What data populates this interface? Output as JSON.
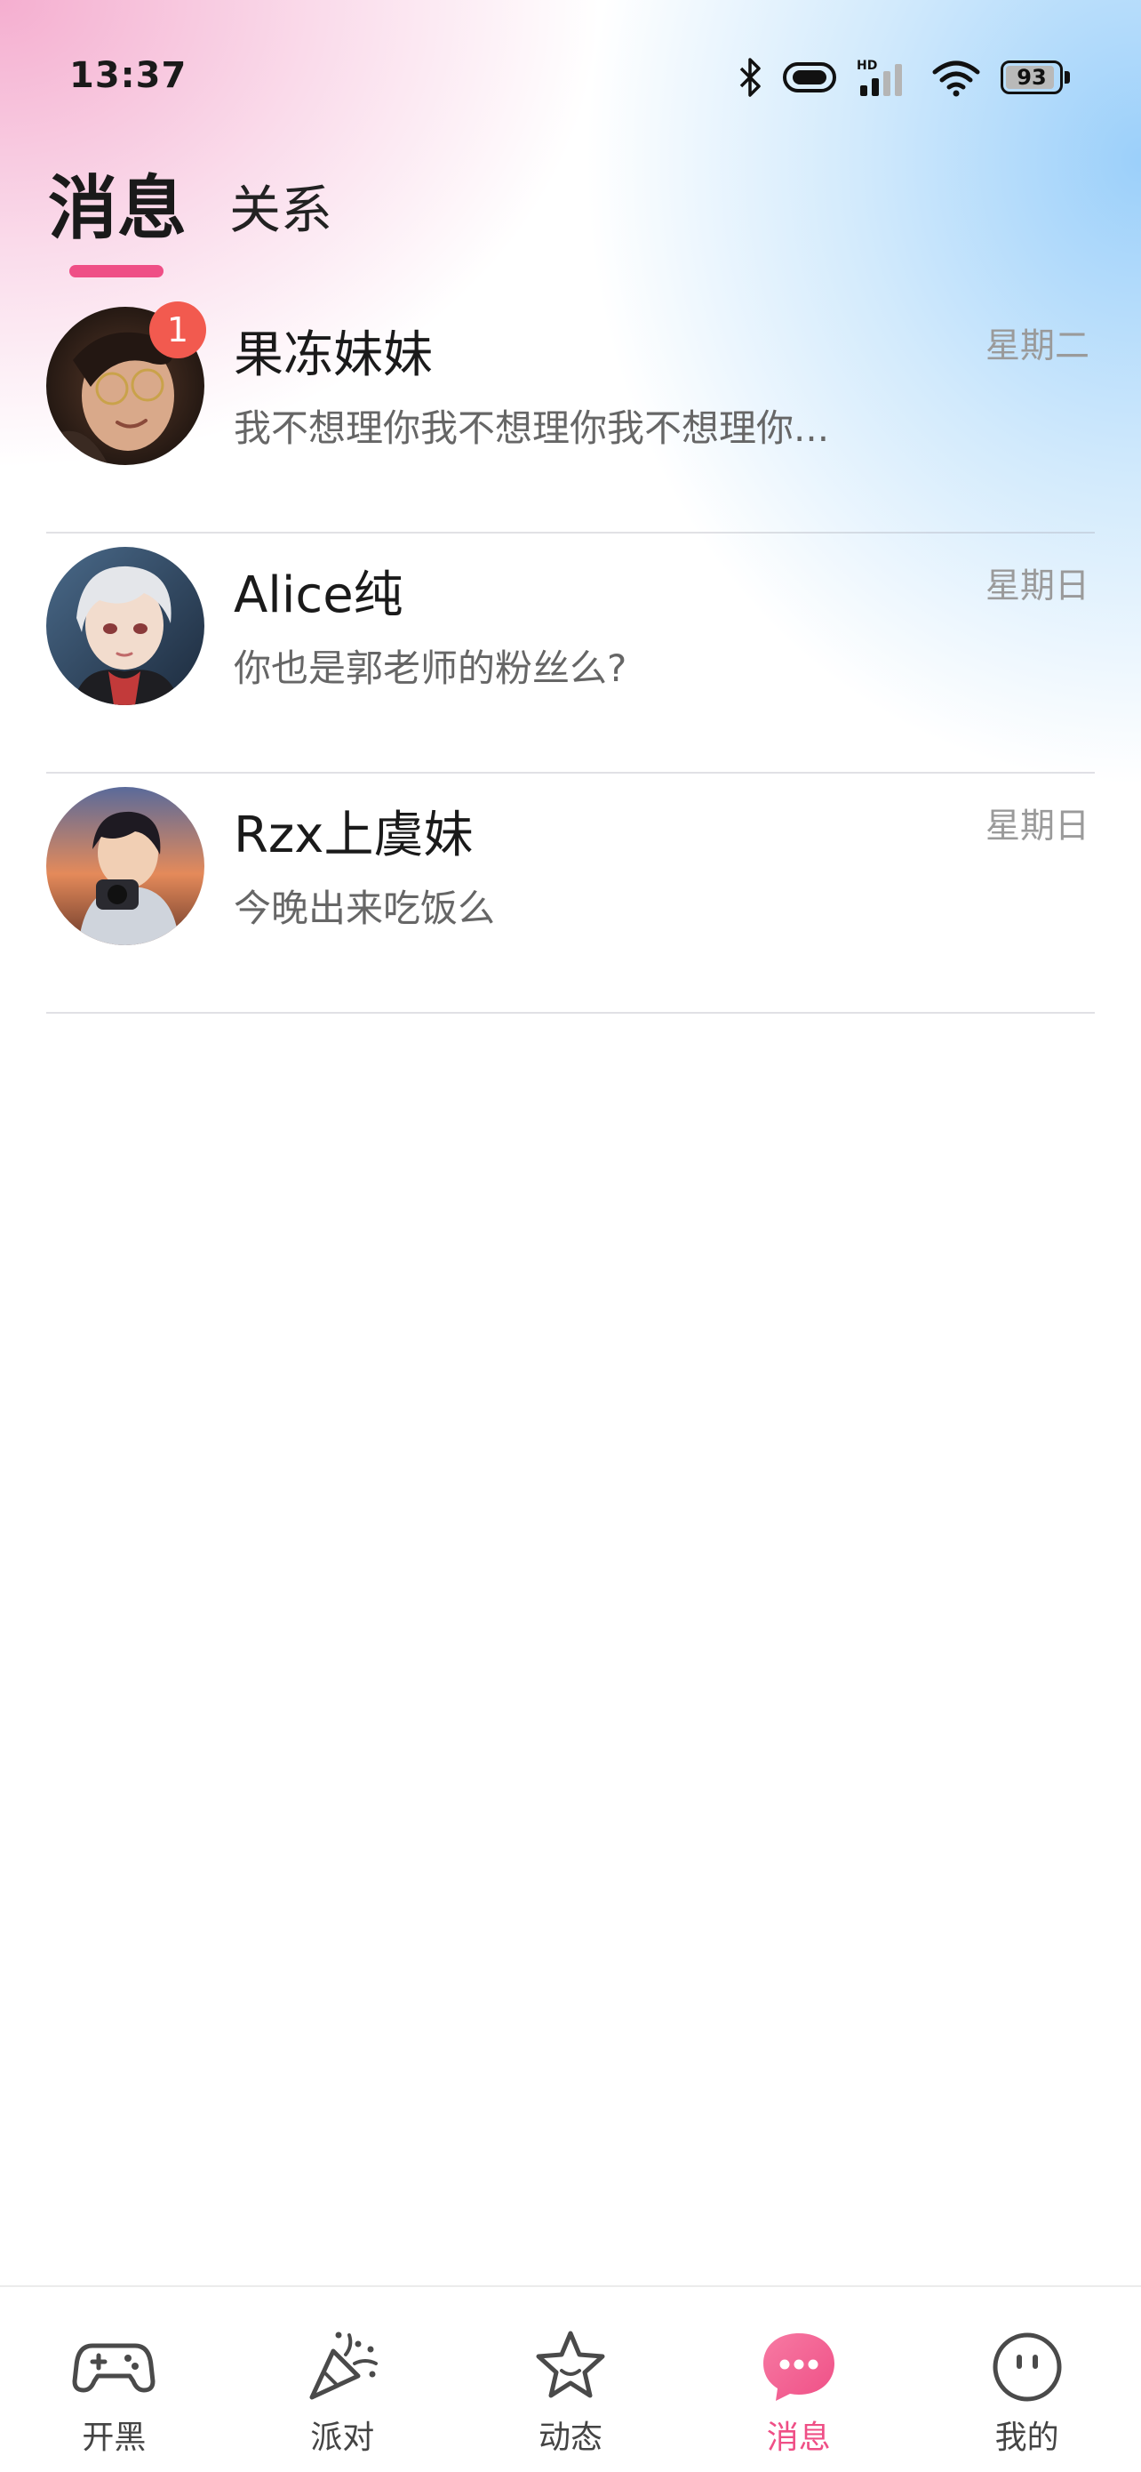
{
  "status_bar": {
    "time": "13:37",
    "battery_percent": "93",
    "battery_level": 0.93,
    "network_label": "HD",
    "icons": [
      "bluetooth-icon",
      "vibrate-icon",
      "cellular-signal-icon",
      "wifi-icon",
      "battery-icon"
    ]
  },
  "tabs": {
    "active_label": "消息",
    "inactive_label": "关系"
  },
  "conversations": [
    {
      "name": "果冻妹妹",
      "preview": "我不想理你我不想理你我不想理你...",
      "time": "星期二",
      "unread": "1"
    },
    {
      "name": "Alice纯",
      "preview": "你也是郭老师的粉丝么?",
      "time": "星期日",
      "unread": ""
    },
    {
      "name": "Rzx上虞妹",
      "preview": "今晚出来吃饭么",
      "time": "星期日",
      "unread": ""
    }
  ],
  "bottom_nav": {
    "items": [
      {
        "label": "开黑",
        "icon": "gamepad-icon"
      },
      {
        "label": "派对",
        "icon": "party-popper-icon"
      },
      {
        "label": "动态",
        "icon": "star-icon"
      },
      {
        "label": "消息",
        "icon": "chat-bubble-icon"
      },
      {
        "label": "我的",
        "icon": "smiley-face-icon"
      }
    ],
    "active_index": 3
  },
  "colors": {
    "accent": "#ef4f86",
    "badge": "#f25a4f"
  }
}
